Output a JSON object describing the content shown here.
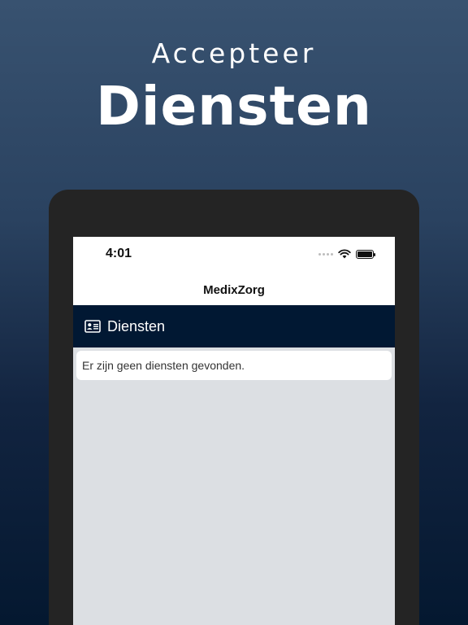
{
  "promo": {
    "subtitle": "Accepteer",
    "title": "Diensten"
  },
  "status_bar": {
    "time": "4:01"
  },
  "nav": {
    "title": "MedixZorg"
  },
  "section": {
    "icon": "id-card-icon",
    "label": "Diensten"
  },
  "empty_state": {
    "message": "Er zijn geen diensten gevonden."
  },
  "colors": {
    "header_bg": "#011833",
    "background_gradient_top": "#385270",
    "background_gradient_bottom": "#041830",
    "content_bg": "#dcdfe3"
  }
}
